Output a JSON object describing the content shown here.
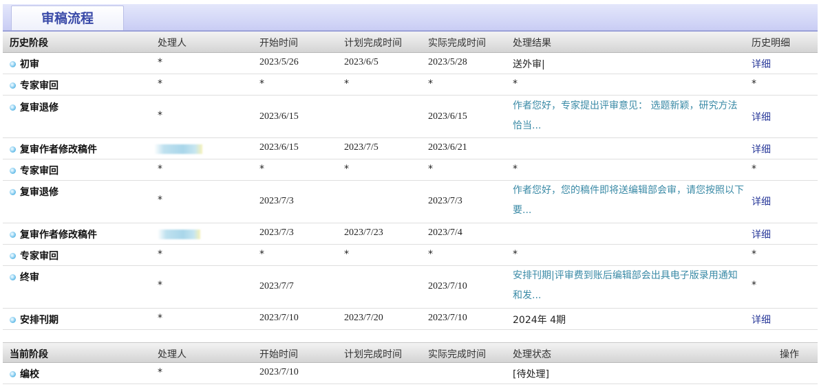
{
  "tab_title": "审稿流程",
  "history_header": {
    "stage": "历史阶段",
    "handler": "处理人",
    "start": "开始时间",
    "planned": "计划完成时间",
    "actual": "实际完成时间",
    "result": "处理结果",
    "detail": "历史明细"
  },
  "history_rows": [
    {
      "stage": "初审",
      "handler": "*",
      "start": "2023/5/26",
      "planned": "2023/6/5",
      "actual": "2023/5/28",
      "result": "送外审|",
      "detail": "详细"
    },
    {
      "stage": "专家审回",
      "handler": "*",
      "start": "*",
      "planned": "*",
      "actual": "*",
      "result": "*",
      "detail": "*"
    },
    {
      "stage": "复审退修",
      "handler": "*",
      "start": "2023/6/15",
      "planned": "",
      "actual": "2023/6/15",
      "result": "作者您好，专家提出评审意见： 选题新颖，研究方法恰当...",
      "detail": "详细"
    },
    {
      "stage": "复审作者修改稿件",
      "handler": "",
      "start": "2023/6/15",
      "planned": "2023/7/5",
      "actual": "2023/6/21",
      "result": "",
      "detail": "详细"
    },
    {
      "stage": "专家审回",
      "handler": "*",
      "start": "*",
      "planned": "*",
      "actual": "*",
      "result": "*",
      "detail": "*"
    },
    {
      "stage": "复审退修",
      "handler": "*",
      "start": "2023/7/3",
      "planned": "",
      "actual": "2023/7/3",
      "result": "作者您好，您的稿件即将送编辑部会审，请您按照以下要...",
      "detail": "详细"
    },
    {
      "stage": "复审作者修改稿件",
      "handler": "",
      "start": "2023/7/3",
      "planned": "2023/7/23",
      "actual": "2023/7/4",
      "result": "",
      "detail": "详细"
    },
    {
      "stage": "专家审回",
      "handler": "*",
      "start": "*",
      "planned": "*",
      "actual": "*",
      "result": "*",
      "detail": "*"
    },
    {
      "stage": "终审",
      "handler": "*",
      "start": "2023/7/7",
      "planned": "",
      "actual": "2023/7/10",
      "result": "安排刊期|评审费到账后编辑部会出具电子版录用通知和发...",
      "detail": "*"
    },
    {
      "stage": "安排刊期",
      "handler": "*",
      "start": "2023/7/10",
      "planned": "2023/7/20",
      "actual": "2023/7/10",
      "result": "2024年 4期",
      "detail": "详细"
    }
  ],
  "current_header": {
    "stage": "当前阶段",
    "handler": "处理人",
    "start": "开始时间",
    "planned": "计划完成时间",
    "actual": "实际完成时间",
    "status": "处理状态",
    "action": "操作"
  },
  "current_rows": [
    {
      "stage": "编校",
      "handler": "*",
      "start": "2023/7/10",
      "planned": "",
      "actual": "",
      "status": "[待处理]",
      "action": ""
    }
  ],
  "colors": {
    "tab_text": "#3a4aa8",
    "link": "#2a3a9a",
    "result_link": "#3a8aa6",
    "bullet": "#5cb8e6"
  }
}
